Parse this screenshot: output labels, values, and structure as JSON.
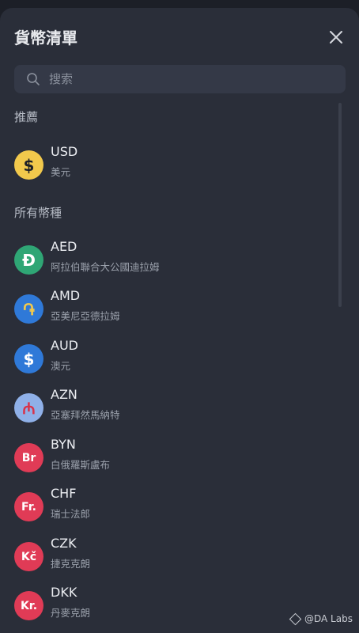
{
  "header": {
    "title": "貨幣清單"
  },
  "search": {
    "placeholder": "搜索"
  },
  "sections": {
    "recommended": "推薦",
    "all": "所有幣種"
  },
  "recommended": [
    {
      "code": "USD",
      "name": "美元",
      "symbol": "$",
      "color": "#f2c94c",
      "fg": "#1c1f27"
    }
  ],
  "currencies": [
    {
      "code": "AED",
      "name": "阿拉伯聯合大公國迪拉姆",
      "symbol": "Đ",
      "color": "#2fa675",
      "fg": "#ffffff"
    },
    {
      "code": "AMD",
      "name": "亞美尼亞德拉姆",
      "symbol": "֏",
      "color": "#2f79d8",
      "fg": "#f2c94c"
    },
    {
      "code": "AUD",
      "name": "澳元",
      "symbol": "$",
      "color": "#2f79d8",
      "fg": "#ffffff"
    },
    {
      "code": "AZN",
      "name": "亞塞拜然馬納特",
      "symbol": "₼",
      "color": "#8fb0e8",
      "fg": "#d8334a"
    },
    {
      "code": "BYN",
      "name": "白俄羅斯盧布",
      "symbol": "Br",
      "color": "#e03b56",
      "fg": "#ffffff"
    },
    {
      "code": "CHF",
      "name": "瑞士法郎",
      "symbol": "Fr.",
      "color": "#e03b56",
      "fg": "#ffffff"
    },
    {
      "code": "CZK",
      "name": "捷克克朗",
      "symbol": "Kč",
      "color": "#e03b56",
      "fg": "#ffffff"
    },
    {
      "code": "DKK",
      "name": "丹麥克朗",
      "symbol": "Kr.",
      "color": "#e03b56",
      "fg": "#ffffff"
    }
  ],
  "watermark": {
    "text": "@DA Labs"
  }
}
